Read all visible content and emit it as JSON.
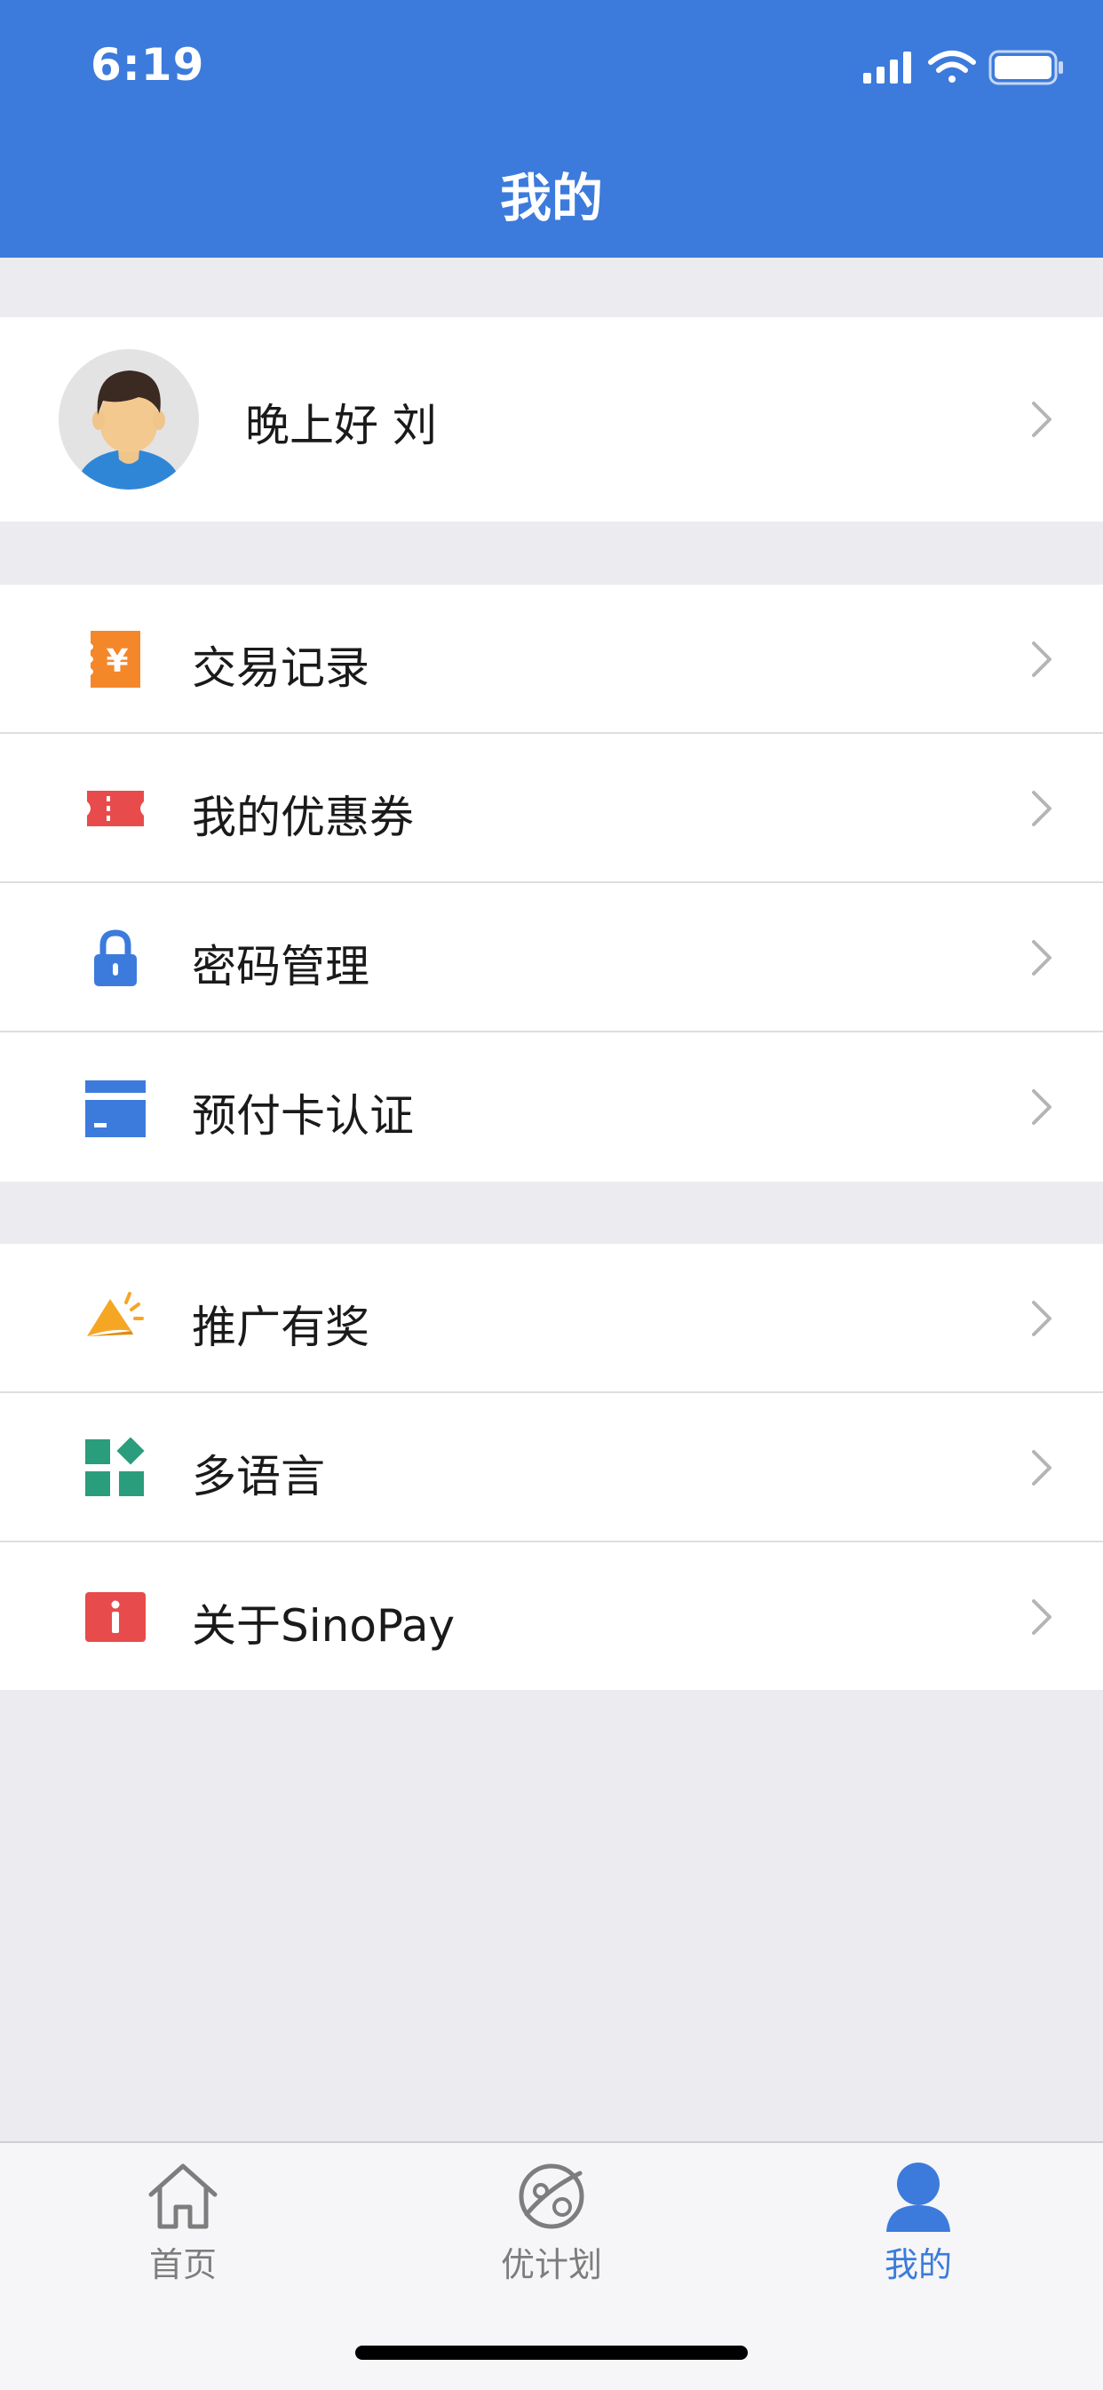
{
  "status_bar": {
    "time": "6:19"
  },
  "header": {
    "title": "我的"
  },
  "profile": {
    "greeting": "晚上好 刘"
  },
  "menu_group_1": [
    {
      "label": "交易记录",
      "icon": "transaction-record-icon",
      "color": "#f5872b"
    },
    {
      "label": "我的优惠券",
      "icon": "coupon-icon",
      "color": "#e84b4b"
    },
    {
      "label": "密码管理",
      "icon": "lock-icon",
      "color": "#3c7bdc"
    },
    {
      "label": "预付卡认证",
      "icon": "card-icon",
      "color": "#3c7bdc"
    }
  ],
  "menu_group_2": [
    {
      "label": "推广有奖",
      "icon": "megaphone-icon",
      "color": "#f5a623"
    },
    {
      "label": "多语言",
      "icon": "apps-icon",
      "color": "#2a9d7c"
    },
    {
      "label": "关于SinoPay",
      "icon": "info-icon",
      "color": "#e84b4b"
    }
  ],
  "tab_bar": {
    "items": [
      {
        "label": "首页",
        "icon": "home-icon",
        "active": false
      },
      {
        "label": "优计划",
        "icon": "planet-icon",
        "active": false
      },
      {
        "label": "我的",
        "icon": "user-icon",
        "active": true
      }
    ],
    "active_color": "#3c7bdc",
    "inactive_color": "#7d7d7d"
  }
}
